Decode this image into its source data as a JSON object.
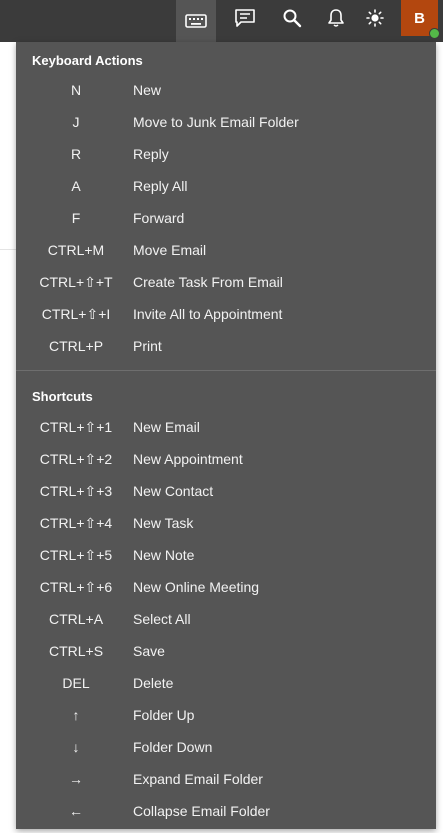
{
  "user": {
    "initial": "B"
  },
  "icons": {
    "keyboard": "keyboard-icon",
    "feedback": "feedback-icon",
    "search": "search-icon",
    "notifications": "bell-icon",
    "theme": "brightness-icon"
  },
  "colors": {
    "topbar": "#3b3b3b",
    "panel": "#555555",
    "avatar": "#b3470f",
    "presence": "#54b848"
  },
  "keyboard_actions": {
    "title": "Keyboard Actions",
    "items": [
      {
        "key": "N",
        "action": "New"
      },
      {
        "key": "J",
        "action": "Move to Junk Email Folder"
      },
      {
        "key": "R",
        "action": "Reply"
      },
      {
        "key": "A",
        "action": "Reply All"
      },
      {
        "key": "F",
        "action": "Forward"
      },
      {
        "key": "CTRL+M",
        "action": "Move Email"
      },
      {
        "key": "CTRL+⇧+T",
        "action": "Create Task From Email"
      },
      {
        "key": "CTRL+⇧+I",
        "action": "Invite All to Appointment"
      },
      {
        "key": "CTRL+P",
        "action": "Print"
      }
    ]
  },
  "shortcuts": {
    "title": "Shortcuts",
    "items": [
      {
        "key": "CTRL+⇧+1",
        "action": "New Email"
      },
      {
        "key": "CTRL+⇧+2",
        "action": "New Appointment"
      },
      {
        "key": "CTRL+⇧+3",
        "action": "New Contact"
      },
      {
        "key": "CTRL+⇧+4",
        "action": "New Task"
      },
      {
        "key": "CTRL+⇧+5",
        "action": "New Note"
      },
      {
        "key": "CTRL+⇧+6",
        "action": "New Online Meeting"
      },
      {
        "key": "CTRL+A",
        "action": "Select All"
      },
      {
        "key": "CTRL+S",
        "action": "Save"
      },
      {
        "key": "DEL",
        "action": "Delete"
      },
      {
        "key": "↑",
        "action": "Folder Up"
      },
      {
        "key": "↓",
        "action": "Folder Down"
      },
      {
        "key": "→",
        "action": "Expand Email Folder"
      },
      {
        "key": "←",
        "action": "Collapse Email Folder"
      }
    ]
  }
}
